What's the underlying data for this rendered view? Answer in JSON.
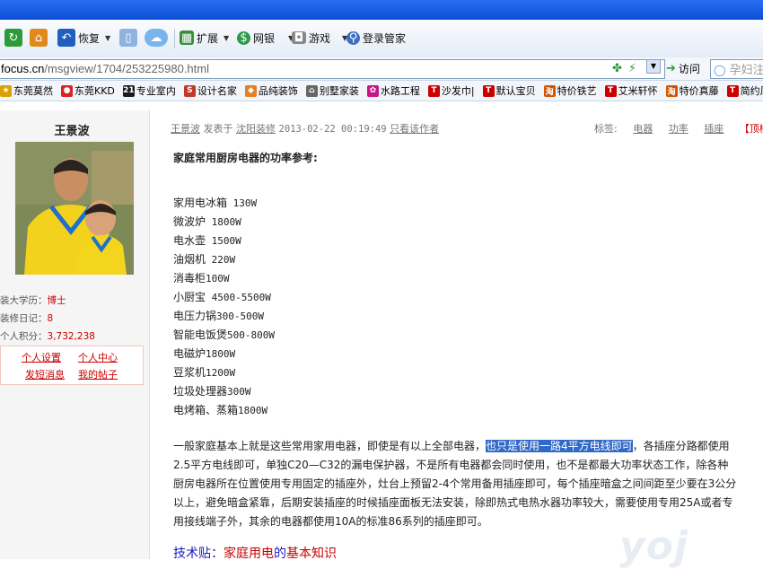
{
  "toolbar": {
    "restore": "恢复",
    "extend": "扩展",
    "netbank": "网银",
    "games": "游戏",
    "login_manager": "登录管家"
  },
  "address": {
    "url_domain": "focus.cn",
    "url_path": "/msgview/1704/253225980.html",
    "visit": "访问",
    "search_placeholder": "孕妇注"
  },
  "favorites": [
    {
      "label": "东莞莫然",
      "color": "#d9a200",
      "glyph": "★"
    },
    {
      "label": "东莞KKD",
      "color": "#d22",
      "glyph": "●"
    },
    {
      "label": "专业室内",
      "color": "#1a1a1a",
      "glyph": "21"
    },
    {
      "label": "设计名家",
      "color": "#c0392b",
      "glyph": "S"
    },
    {
      "label": "品纯装饰",
      "color": "#e67e22",
      "glyph": "◆"
    },
    {
      "label": "别墅家装",
      "color": "#666",
      "glyph": "⌂"
    },
    {
      "label": "水路工程",
      "color": "#c71585",
      "glyph": "✿"
    },
    {
      "label": "沙发巾|",
      "color": "#c00",
      "glyph": "T"
    },
    {
      "label": "默认宝贝",
      "color": "#c00",
      "glyph": "T"
    },
    {
      "label": "特价铁艺",
      "color": "#d35400",
      "glyph": "淘"
    },
    {
      "label": "艾米轩怀",
      "color": "#c00",
      "glyph": "T"
    },
    {
      "label": "特价真藤",
      "color": "#d35400",
      "glyph": "淘"
    },
    {
      "label": "简约风",
      "color": "#c00",
      "glyph": "T"
    }
  ],
  "sidebar": {
    "username": "王景波",
    "stats": [
      {
        "label": "装大学历：",
        "value": "博士"
      },
      {
        "label": "装修日记：",
        "value": "8"
      },
      {
        "label": "个人积分：",
        "value": "3,732,238"
      }
    ],
    "links": {
      "settings": "个人设置",
      "center": "个人中心",
      "message": "发短消息",
      "posts": "我的帖子"
    }
  },
  "post": {
    "author": "王景波",
    "posted_in": "发表于",
    "forum": "沈阳装修",
    "time": "2013-02-22 00:19:49",
    "only_author": "只看该作者",
    "tags_label": "标签:",
    "tags": [
      "电器",
      "功率",
      "插座"
    ],
    "top": "【顶楼】",
    "heading": "家庭常用厨房电器的功率参考:",
    "appliances": [
      {
        "name": "家用电冰箱",
        "power": " 130W"
      },
      {
        "name": "微波炉",
        "power": " 1800W"
      },
      {
        "name": "电水壶",
        "power": " 1500W"
      },
      {
        "name": "油烟机",
        "power": " 220W"
      },
      {
        "name": "消毒柜",
        "power": "100W"
      },
      {
        "name": "小厨宝",
        "power": " 4500-5500W"
      },
      {
        "name": "电压力锅",
        "power": "300-500W"
      },
      {
        "name": "智能电饭煲",
        "power": "500-800W"
      },
      {
        "name": "电磁炉",
        "power": "1800W"
      },
      {
        "name": "豆浆机",
        "power": "1200W"
      },
      {
        "name": "垃圾处理器",
        "power": "300W"
      },
      {
        "name": "电烤箱、蒸箱",
        "power": "1800W"
      }
    ],
    "para_before": "一般家庭基本上就是这些常用家用电器，即使是有以上全部电器，",
    "para_highlight": "也只是使用一路4平方电线即可",
    "para_after": "，各插座分路都使用2.5平方电线即可，单独C20—C32的漏电保护器，不是所有电器都会同时使用，也不是都最大功率状态工作，除各种厨房电器所在位置使用专用固定的插座外，灶台上预留2-4个常用备用插座即可，每个插座暗盒之间间距至少要在3公分以上，避免暗盒紧靠，后期安装插座的时候插座面板无法安装，除即热式电热水器功率较大，需要使用专用25A或者专用接线端子外，其余的电器都使用10A的标准86系列的插座即可。",
    "tip_label": "技术贴：",
    "tip_a": "家庭用电",
    "tip_b": "的",
    "tip_c": "基本知识"
  }
}
